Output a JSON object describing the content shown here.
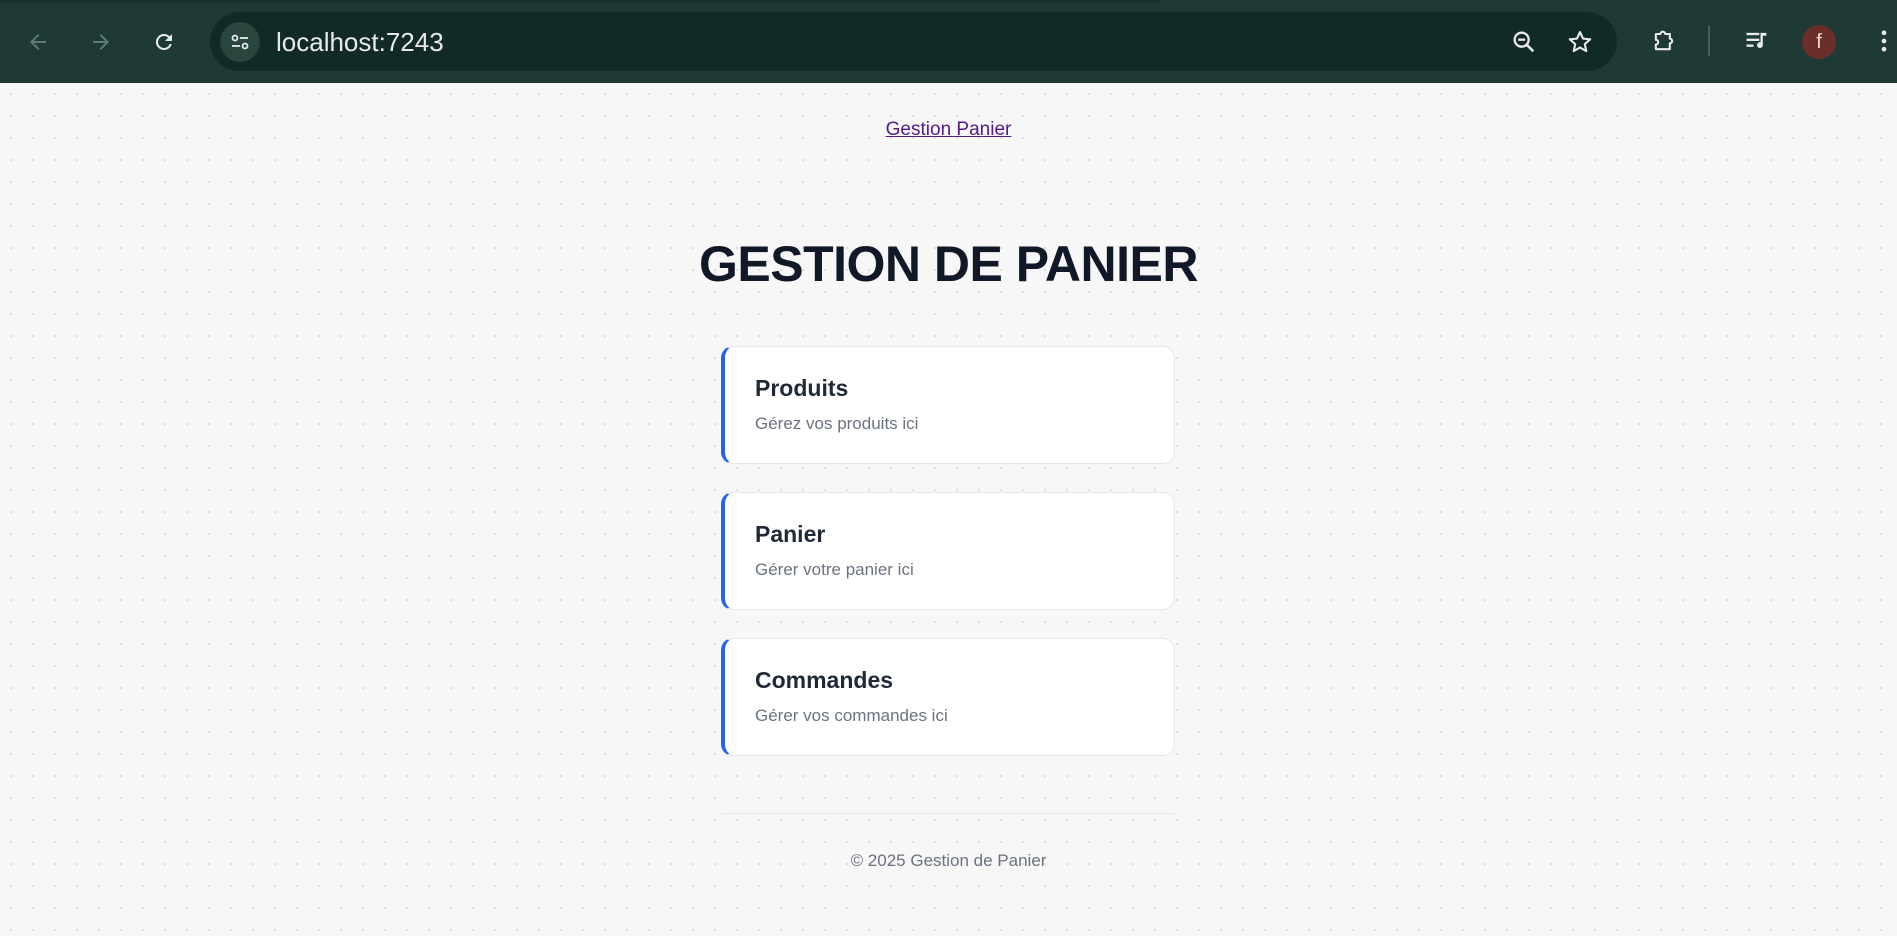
{
  "browser": {
    "url": "localhost:7243",
    "profile_initial": "f",
    "icons": {
      "back": "arrow-left-icon",
      "forward": "arrow-right-icon",
      "reload": "reload-icon",
      "site_info": "tune-icon",
      "zoom": "zoom-out-icon",
      "bookmark": "star-icon",
      "extensions": "puzzle-icon",
      "media": "playlist-icon",
      "menu": "kebab-menu-icon"
    }
  },
  "page": {
    "nav_link": "Gestion Panier",
    "title": "GESTION DE PANIER",
    "cards": [
      {
        "title": "Produits",
        "description": "Gérez vos produits ici"
      },
      {
        "title": "Panier",
        "description": "Gérer votre panier ici"
      },
      {
        "title": "Commandes",
        "description": "Gérer vos commandes ici"
      }
    ],
    "footer": "© 2025 Gestion de Panier"
  },
  "colors": {
    "chrome_bg": "#1f3a34",
    "accent": "#2563eb",
    "title_text": "#111827",
    "muted_text": "#6b7280",
    "link_visited": "#551a8b"
  }
}
